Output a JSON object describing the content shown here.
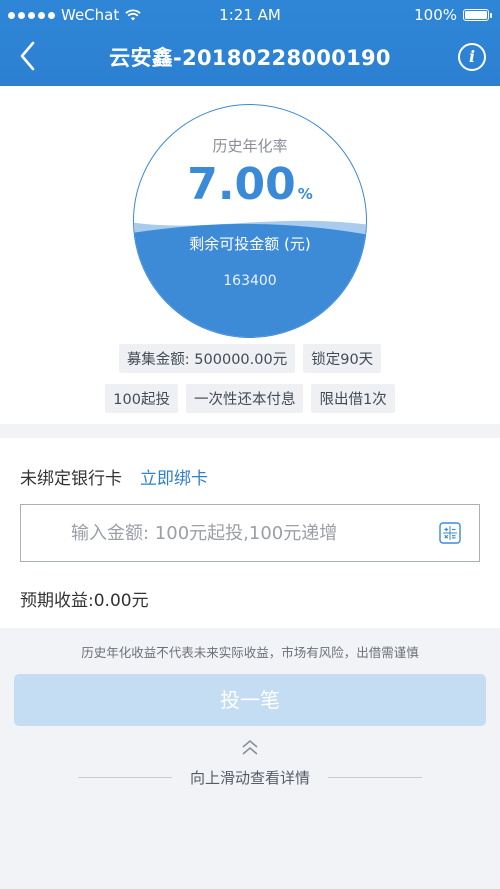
{
  "status_bar": {
    "carrier": "WeChat",
    "time": "1:21 AM",
    "battery": "100%"
  },
  "nav": {
    "title": "云安鑫-20180228000190",
    "info_icon": "i"
  },
  "product": {
    "rate_label": "历史年化率",
    "rate_value": "7.00",
    "rate_unit": "%",
    "remaining_label": "剩余可投金额 (元)",
    "remaining_value": "163400",
    "fill_level": 0.48,
    "tags_row1": [
      "募集金额: 500000.00元",
      "锁定90天"
    ],
    "tags_row2": [
      "100起投",
      "一次性还本付息",
      "限出借1次"
    ]
  },
  "form": {
    "bank_status": "未绑定银行卡",
    "bind_link": "立即绑卡",
    "amount_placeholder": "输入金额: 100元起投,100元递增",
    "expected_label": "预期收益:",
    "expected_value": "0.00元"
  },
  "footer": {
    "disclaimer": "历史年化收益不代表未来实际收益，市场有风险，出借需谨慎",
    "invest_button": "投一笔",
    "swipe_hint": "向上滑动查看详情"
  },
  "colors": {
    "brand": "#2f86d6",
    "button_disabled": "#c4ddf3"
  },
  "icons": [
    "back-chevron-icon",
    "info-icon",
    "calculator-icon",
    "double-chevron-up-icon",
    "wifi-icon",
    "battery-icon"
  ]
}
